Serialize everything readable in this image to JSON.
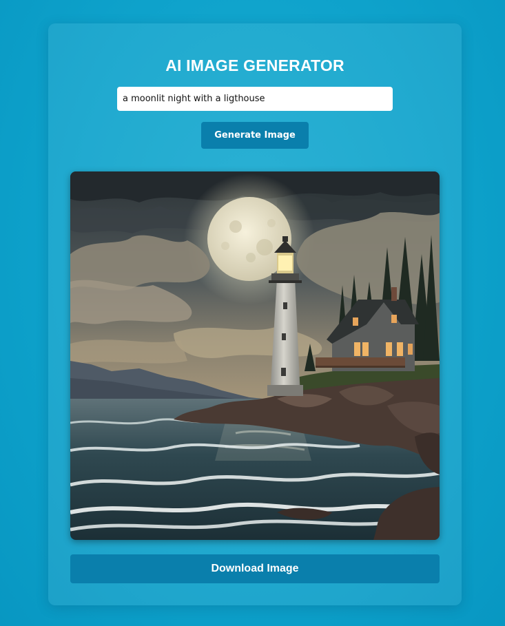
{
  "app": {
    "title": "AI IMAGE GENERATOR"
  },
  "prompt": {
    "value": "a moonlit night with a ligthouse",
    "placeholder": ""
  },
  "buttons": {
    "generate_label": "Generate Image",
    "download_label": "Download Image"
  },
  "generated_image": {
    "alt": "a moonlit night with a ligthouse"
  },
  "colors": {
    "background": "#0b9fc8",
    "button": "#0a7fac",
    "title_text": "#ffffff"
  }
}
